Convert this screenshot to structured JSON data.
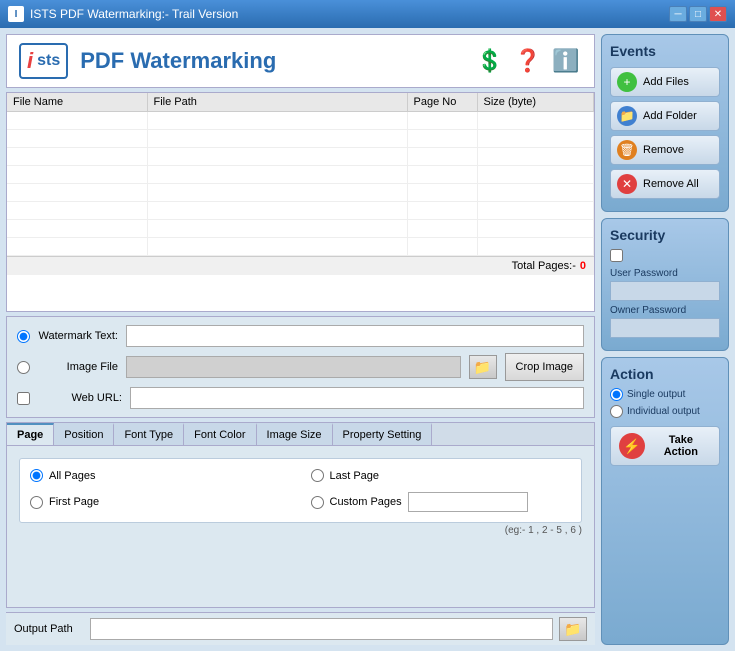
{
  "titleBar": {
    "title": "ISTS PDF Watermarking:- Trail Version",
    "controls": [
      "minimize",
      "maximize",
      "close"
    ]
  },
  "header": {
    "logoI": "i",
    "logoSTS": "sts",
    "appTitle": "PDF Watermarking"
  },
  "fileTable": {
    "columns": [
      "File Name",
      "File Path",
      "Page No",
      "Size (byte)"
    ],
    "rows": [],
    "totalPagesLabel": "Total Pages:-",
    "totalPagesValue": "0"
  },
  "watermarkOptions": {
    "watermarkTextLabel": "Watermark Text:",
    "imageFileLabel": "Image File",
    "webUrlLabel": "Web URL:",
    "cropButtonLabel": "Crop Image",
    "browseSymbol": "📁"
  },
  "tabs": {
    "items": [
      "Page",
      "Position",
      "Font Type",
      "Font Color",
      "Image Size",
      "Property Setting"
    ],
    "activeTab": "Page"
  },
  "pageTab": {
    "allPages": "All Pages",
    "firstPage": "First Page",
    "lastPage": "Last Page",
    "customPages": "Custom Pages",
    "egText": "(eg:- 1 , 2 - 5 , 6 )"
  },
  "outputPath": {
    "label": "Output Path"
  },
  "events": {
    "title": "Events",
    "addFiles": "Add Files",
    "addFolder": "Add Folder",
    "remove": "Remove",
    "removeAll": "Remove All"
  },
  "security": {
    "title": "Security",
    "userPasswordLabel": "User Password",
    "ownerPasswordLabel": "Owner Password"
  },
  "action": {
    "title": "Action",
    "singleOutput": "Single output",
    "individualOutput": "Individual output",
    "takeActionLabel": "Take Action",
    "actionSymbol": "⚡"
  }
}
